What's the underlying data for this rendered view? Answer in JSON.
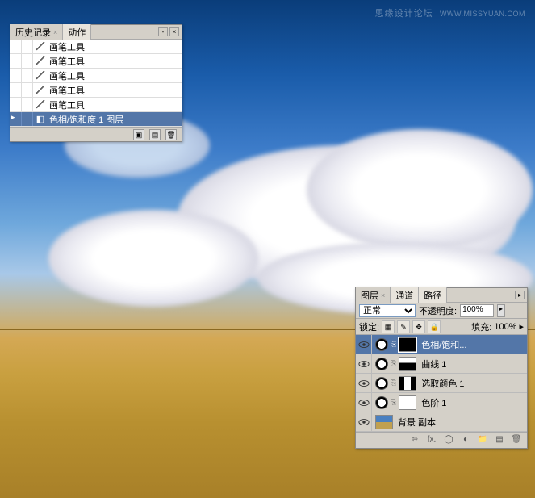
{
  "watermark": {
    "main": "思缘设计论坛",
    "sub": "WWW.MISSYUAN.COM"
  },
  "history_panel": {
    "tabs": [
      {
        "label": "历史记录",
        "active": true
      },
      {
        "label": "动作",
        "active": false
      }
    ],
    "items": [
      {
        "icon": "brush",
        "label": "画笔工具",
        "selected": false
      },
      {
        "icon": "brush",
        "label": "画笔工具",
        "selected": false
      },
      {
        "icon": "brush",
        "label": "画笔工具",
        "selected": false
      },
      {
        "icon": "brush",
        "label": "画笔工具",
        "selected": false
      },
      {
        "icon": "brush",
        "label": "画笔工具",
        "selected": false
      },
      {
        "icon": "adj",
        "label": "色相/饱和度 1 图层",
        "selected": true
      }
    ]
  },
  "layers_panel": {
    "tabs": [
      {
        "label": "图层",
        "active": true
      },
      {
        "label": "通道",
        "active": false
      },
      {
        "label": "路径",
        "active": false
      }
    ],
    "blend_mode": "正常",
    "opacity_label": "不透明度:",
    "opacity_value": "100%",
    "lock_label": "锁定:",
    "fill_label": "填充:",
    "fill_value": "100%",
    "layers": [
      {
        "visible": true,
        "type": "adj",
        "mask": "blk",
        "name": "色相/饱和...",
        "selected": true
      },
      {
        "visible": true,
        "type": "adj",
        "mask": "mix2",
        "name": "曲线 1",
        "selected": false
      },
      {
        "visible": true,
        "type": "adj",
        "mask": "mix",
        "name": "选取颜色 1",
        "selected": false
      },
      {
        "visible": true,
        "type": "adj",
        "mask": "white",
        "name": "色阶 1",
        "selected": false
      },
      {
        "visible": true,
        "type": "img",
        "mask": null,
        "name": "背景 副本",
        "selected": false
      }
    ]
  }
}
